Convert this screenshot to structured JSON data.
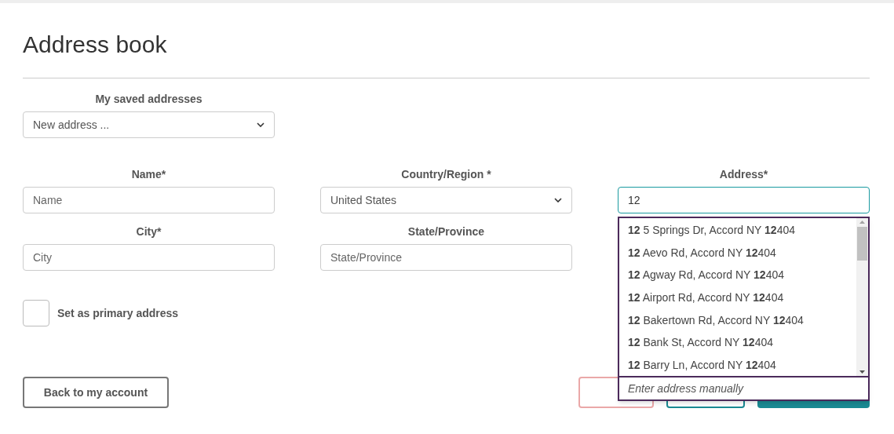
{
  "title": "Address book",
  "saved": {
    "label": "My saved addresses",
    "value": "New address ..."
  },
  "fields": [
    {
      "kind": "input",
      "label": "Name*",
      "placeholder": "Name"
    },
    {
      "kind": "select",
      "label": "Country/Region *",
      "value": "United States"
    },
    {
      "kind": "input",
      "label": "Address*",
      "value": "12",
      "focused": true
    },
    {
      "kind": "input",
      "label": "City*",
      "placeholder": "City"
    },
    {
      "kind": "input",
      "label": "State/Province",
      "placeholder": "State/Province"
    }
  ],
  "primary": {
    "label": "Set as primary address",
    "checked": false
  },
  "suggestions": {
    "items": [
      "**12** 5 Springs Dr, Accord NY **12**404",
      "**12** Aevo Rd, Accord NY **12**404",
      "**12** Agway Rd, Accord NY **12**404",
      "**12** Airport Rd, Accord NY **12**404",
      "**12** Bakertown Rd, Accord NY **12**404",
      "**12** Bank St, Accord NY **12**404",
      "**12** Barry Ln, Accord NY **12**404"
    ],
    "manual": "Enter address manually"
  },
  "back_button": "Back to my account",
  "action_buttons": [
    {
      "kind": "danger"
    },
    {
      "kind": "outline"
    },
    {
      "kind": "primary"
    }
  ]
}
